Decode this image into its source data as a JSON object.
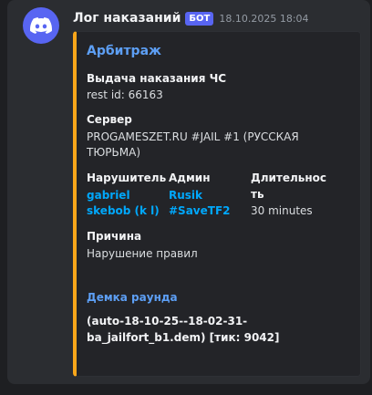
{
  "message": {
    "author": "Лог наказаний",
    "badge": "БОТ",
    "timestamp": "18.10.2025 18:04",
    "avatar_icon": "discord-logo-icon",
    "avatar_color": "#5865f2"
  },
  "embed": {
    "accent_color": "#faa61a",
    "title": "Арбитраж",
    "sections": {
      "ban_title": "Выдача наказания ЧС",
      "rest_id": "rest id: 66163",
      "server_label": "Сервер",
      "server_line1": "PROGAMESZET.RU #JAIL #1 (РУССКАЯ",
      "server_line2": "ТЮРЬМА)"
    },
    "fields": {
      "offender_label": "Нарушитель",
      "offender_name1": "gabriel",
      "offender_name2": "skebob (k l)",
      "admin_label": "Админ",
      "admin_name1": "Rusik",
      "admin_name2": "#SaveTF2",
      "duration_label1": "Длительнос",
      "duration_label2": "ть",
      "duration_value": "30 minutes"
    },
    "reason": {
      "label": "Причина",
      "value": "Нарушение правил"
    },
    "demo": {
      "label": "Демка раунда",
      "line1": "(auto-18-10-25--18-02-31-",
      "line2": "ba_jailfort_b1.dem) [тик: 9042]"
    }
  }
}
